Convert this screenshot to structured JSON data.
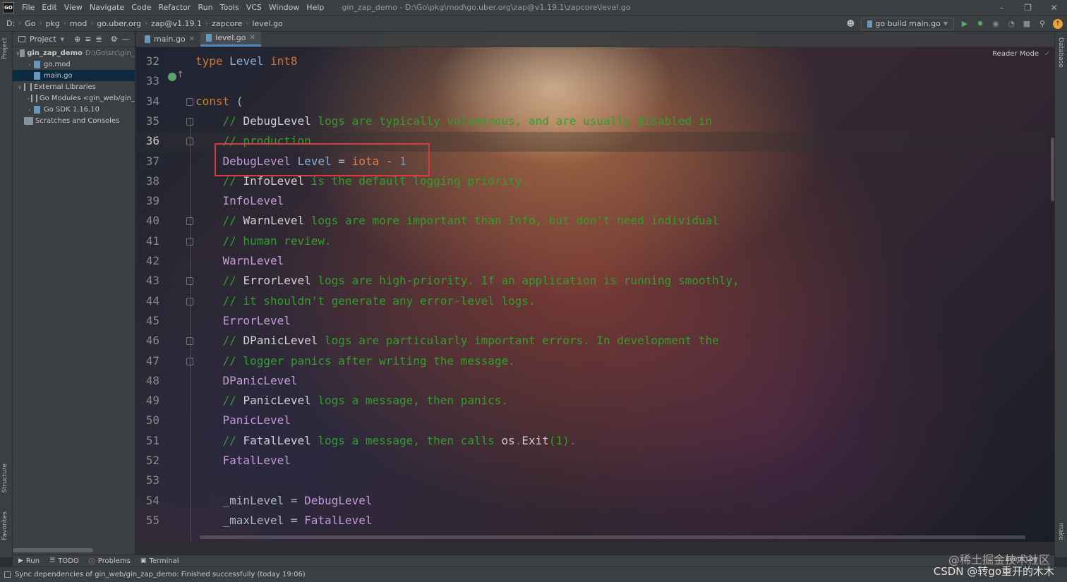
{
  "menubar": {
    "logo": "GO",
    "items": [
      "File",
      "Edit",
      "View",
      "Navigate",
      "Code",
      "Refactor",
      "Run",
      "Tools",
      "VCS",
      "Window",
      "Help"
    ],
    "window_title": "gin_zap_demo - D:\\Go\\pkg\\mod\\go.uber.org\\zap@v1.19.1\\zapcore\\level.go"
  },
  "breadcrumbs": [
    "D:",
    "Go",
    "pkg",
    "mod",
    "go.uber.org",
    "zap@v1.19.1",
    "zapcore",
    "level.go"
  ],
  "run_config": {
    "label": "go build main.go"
  },
  "project_panel": {
    "title": "Project",
    "tree": [
      {
        "label": "gin_zap_demo",
        "sub": "D:\\Go\\src\\gin_",
        "depth": 0,
        "expanded": true,
        "icon": "folder-icon",
        "bold": true
      },
      {
        "label": "go.mod",
        "depth": 1,
        "expanded": false,
        "icon": "go-mod-file-icon"
      },
      {
        "label": "main.go",
        "depth": 1,
        "icon": "go-file-icon",
        "selected": true
      },
      {
        "label": "External Libraries",
        "depth": 0,
        "expanded": true,
        "icon": "library-icon"
      },
      {
        "label": "Go Modules <gin_web/gin_",
        "depth": 1,
        "expanded": false,
        "icon": "library-icon"
      },
      {
        "label": "Go SDK 1.16.10",
        "depth": 1,
        "expanded": false,
        "icon": "go-sdk-icon"
      },
      {
        "label": "Scratches and Consoles",
        "depth": 0,
        "icon": "scratches-icon"
      }
    ]
  },
  "left_strip": {
    "project": "Project",
    "structure": "Structure",
    "favorites": "Favorites"
  },
  "right_strip": {
    "database": "Database",
    "make": "make"
  },
  "editor": {
    "tabs": [
      {
        "label": "main.go",
        "active": false
      },
      {
        "label": "level.go",
        "active": true
      }
    ],
    "reader_mode": "Reader Mode",
    "current_line": 36,
    "lines": [
      {
        "n": 32,
        "tokens": [
          [
            "kw",
            "type "
          ],
          [
            "tp",
            "Level "
          ],
          [
            "kw",
            "int8"
          ]
        ]
      },
      {
        "n": 33,
        "tokens": []
      },
      {
        "n": 34,
        "tokens": [
          [
            "kw",
            "const "
          ],
          [
            "op",
            "("
          ]
        ]
      },
      {
        "n": 35,
        "tokens": [
          [
            "cm",
            "    // "
          ],
          [
            "cm-id",
            "DebugLevel"
          ],
          [
            "cm",
            " logs are typically voluminous, and are usually disabled in"
          ]
        ]
      },
      {
        "n": 36,
        "tokens": [
          [
            "cm",
            "    // production."
          ]
        ]
      },
      {
        "n": 37,
        "tokens": [
          [
            "cst",
            "    DebugLevel "
          ],
          [
            "tp",
            "Level "
          ],
          [
            "op",
            "= "
          ],
          [
            "iota",
            "iota "
          ],
          [
            "op",
            "- "
          ],
          [
            "num",
            "1"
          ]
        ]
      },
      {
        "n": 38,
        "tokens": [
          [
            "cm",
            "    // "
          ],
          [
            "cm-id",
            "InfoLevel"
          ],
          [
            "cm",
            " is the default logging priority."
          ]
        ]
      },
      {
        "n": 39,
        "tokens": [
          [
            "cst",
            "    InfoLevel"
          ]
        ]
      },
      {
        "n": 40,
        "tokens": [
          [
            "cm",
            "    // "
          ],
          [
            "cm-id",
            "WarnLevel"
          ],
          [
            "cm",
            " logs are more important than Info, but don't need individual"
          ]
        ]
      },
      {
        "n": 41,
        "tokens": [
          [
            "cm",
            "    // human review."
          ]
        ]
      },
      {
        "n": 42,
        "tokens": [
          [
            "cst",
            "    WarnLevel"
          ]
        ]
      },
      {
        "n": 43,
        "tokens": [
          [
            "cm",
            "    // "
          ],
          [
            "cm-id",
            "ErrorLevel"
          ],
          [
            "cm",
            " logs are high-priority. If an application is running smoothly,"
          ]
        ]
      },
      {
        "n": 44,
        "tokens": [
          [
            "cm",
            "    // it shouldn't generate any error-level logs."
          ]
        ]
      },
      {
        "n": 45,
        "tokens": [
          [
            "cst",
            "    ErrorLevel"
          ]
        ]
      },
      {
        "n": 46,
        "tokens": [
          [
            "cm",
            "    // "
          ],
          [
            "cm-id",
            "DPanicLevel"
          ],
          [
            "cm",
            " logs are particularly important errors. In development the"
          ]
        ]
      },
      {
        "n": 47,
        "tokens": [
          [
            "cm",
            "    // logger panics after writing the message."
          ]
        ]
      },
      {
        "n": 48,
        "tokens": [
          [
            "cst",
            "    DPanicLevel"
          ]
        ]
      },
      {
        "n": 49,
        "tokens": [
          [
            "cm",
            "    // "
          ],
          [
            "cm-id",
            "PanicLevel"
          ],
          [
            "cm",
            " logs a message, then panics."
          ]
        ]
      },
      {
        "n": 50,
        "tokens": [
          [
            "cst",
            "    PanicLevel"
          ]
        ]
      },
      {
        "n": 51,
        "tokens": [
          [
            "cm",
            "    // "
          ],
          [
            "cm-id",
            "FatalLevel"
          ],
          [
            "cm",
            " logs a message, then calls "
          ],
          [
            "cm-id",
            "os"
          ],
          [
            "cm",
            "."
          ],
          [
            "cm-id",
            "Exit"
          ],
          [
            "cm",
            "(1)."
          ]
        ]
      },
      {
        "n": 52,
        "tokens": [
          [
            "cst",
            "    FatalLevel"
          ]
        ]
      },
      {
        "n": 53,
        "tokens": []
      },
      {
        "n": 54,
        "tokens": [
          [
            "id",
            "    _minLevel "
          ],
          [
            "op",
            "= "
          ],
          [
            "cst",
            "DebugLevel"
          ]
        ]
      },
      {
        "n": 55,
        "tokens": [
          [
            "id",
            "    _maxLevel "
          ],
          [
            "op",
            "= "
          ],
          [
            "cst",
            "FatalLevel"
          ]
        ]
      }
    ]
  },
  "bottom_tabs": [
    {
      "label": "Run",
      "icon": "play-icon"
    },
    {
      "label": "TODO",
      "icon": "list-icon"
    },
    {
      "label": "Problems",
      "icon": "info-icon"
    },
    {
      "label": "Terminal",
      "icon": "terminal-icon"
    }
  ],
  "event_log": "Event Log",
  "status": {
    "message": "Sync dependencies of gin_web/gin_zap_demo: Finished successfully (today 19:06)"
  },
  "watermarks": {
    "juejin": "@稀土掘金技术社区",
    "csdn": "CSDN @转go重开的木木"
  }
}
